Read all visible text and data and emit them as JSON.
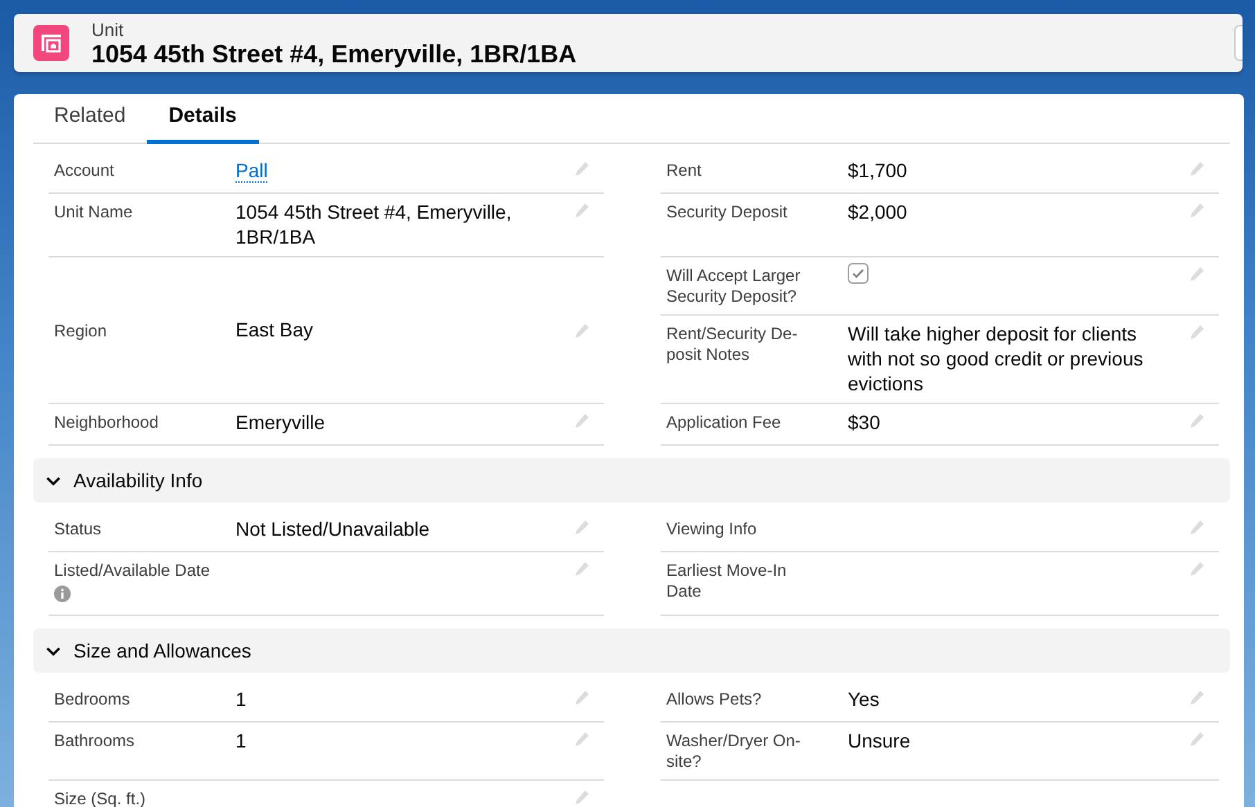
{
  "header": {
    "object_type": "Unit",
    "title": "1054 45th Street #4, Emeryville, 1BR/1BA"
  },
  "tabs": [
    {
      "label": "Related",
      "selected": false
    },
    {
      "label": "Details",
      "selected": true
    }
  ],
  "sections": [
    {
      "rows": [
        {
          "left": [
            {
              "label": "Account",
              "value": "Pall",
              "kind": "link"
            }
          ],
          "right": [
            {
              "label": "Rent",
              "value": "$1,700",
              "kind": "text"
            }
          ]
        },
        {
          "left": [
            {
              "label": "Unit Name",
              "value": "1054 45th Street #4, Emeryville, 1BR/1BA",
              "kind": "text"
            }
          ],
          "right": [
            {
              "label": "Security Deposit",
              "value": "$2,000",
              "kind": "text"
            }
          ]
        },
        {
          "left": [
            {
              "label": "Region",
              "value": "East Bay",
              "kind": "text"
            }
          ],
          "right": [
            {
              "label": "Will Accept Larger Security Deposit?",
              "checked": true,
              "kind": "checkbox"
            },
            {
              "label": "Rent/Security De-posit Notes",
              "value": "Will take higher deposit for clients with not so good credit or previous evictions",
              "kind": "text"
            }
          ]
        },
        {
          "left": [
            {
              "label": "Neighborhood",
              "value": "Emeryville",
              "kind": "text"
            }
          ],
          "right": [
            {
              "label": "Application Fee",
              "value": "$30",
              "kind": "text"
            }
          ]
        }
      ]
    },
    {
      "title": "Availability Info",
      "expanded": true,
      "rows": [
        {
          "left": [
            {
              "label": "Status",
              "value": "Not Listed/Unavailable",
              "kind": "text"
            }
          ],
          "right": [
            {
              "label": "Viewing Info",
              "kind": "text"
            }
          ]
        },
        {
          "left": [
            {
              "label": "Listed/Available Date",
              "kind": "text",
              "info": true
            }
          ],
          "right": [
            {
              "label": "Earliest Move-In Date",
              "kind": "text"
            }
          ]
        }
      ]
    },
    {
      "title": "Size and Allowances",
      "expanded": true,
      "rows": [
        {
          "left": [
            {
              "label": "Bedrooms",
              "value": "1",
              "kind": "text"
            }
          ],
          "right": [
            {
              "label": "Allows Pets?",
              "value": "Yes",
              "kind": "text"
            }
          ]
        },
        {
          "left": [
            {
              "label": "Bathrooms",
              "value": "1",
              "kind": "text"
            }
          ],
          "right": [
            {
              "label": "Washer/Dryer On-site?",
              "value": "Unsure",
              "kind": "text"
            }
          ]
        },
        {
          "left": [
            {
              "label": "Size (Sq. ft.)",
              "kind": "text"
            }
          ],
          "right": []
        }
      ]
    }
  ]
}
